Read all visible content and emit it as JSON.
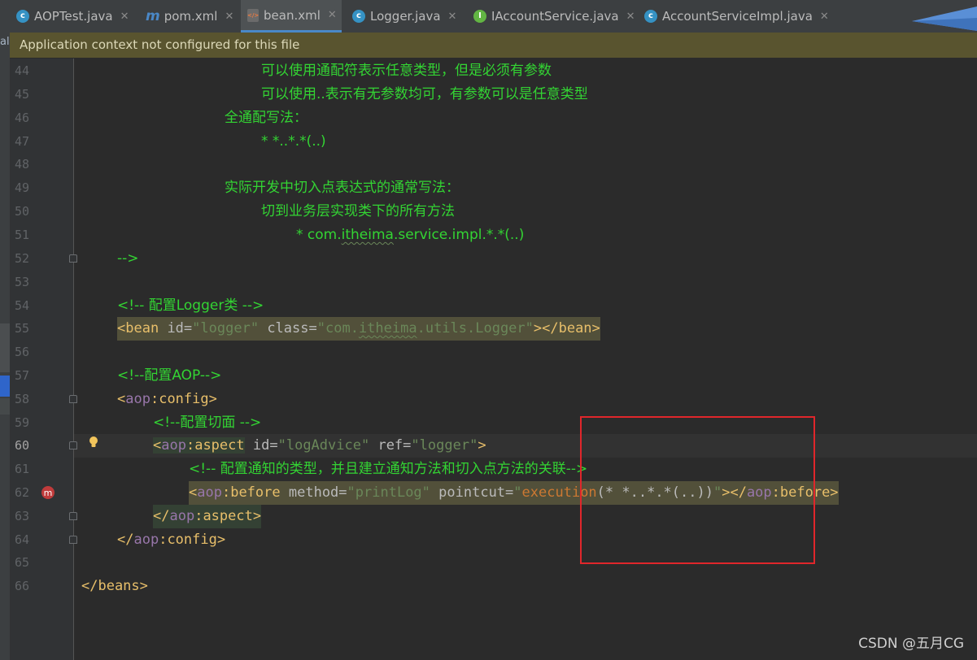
{
  "tabs": [
    {
      "label": "AOPTest.java",
      "icon": "class-icon"
    },
    {
      "label": "pom.xml",
      "icon": "maven-icon"
    },
    {
      "label": "bean.xml",
      "icon": "xml-icon",
      "active": true
    },
    {
      "label": "Logger.java",
      "icon": "class-icon"
    },
    {
      "label": "IAccountService.java",
      "icon": "interface-icon"
    },
    {
      "label": "AccountServiceImpl.java",
      "icon": "class-icon"
    }
  ],
  "side_char": "al",
  "banner": "Application context not configured for this file",
  "lines": {
    "l44": {
      "num": "44",
      "c": "可以使用通配符表示任意类型，但是必须有参数"
    },
    "l45": {
      "num": "45",
      "c": "可以使用..表示有无参数均可，有参数可以是任意类型"
    },
    "l46": {
      "num": "46",
      "c": "全通配写法："
    },
    "l47": {
      "num": "47",
      "c": "* *..*.*(..)"
    },
    "l48": {
      "num": "48"
    },
    "l49": {
      "num": "49",
      "c": "实际开发中切入点表达式的通常写法："
    },
    "l50": {
      "num": "50",
      "c": "切到业务层实现类下的所有方法"
    },
    "l51": {
      "num": "51",
      "c1": "* com.",
      "c2": "itheima",
      "c3": ".service.impl.*.*(..)"
    },
    "l52": {
      "num": "52",
      "c": "-->"
    },
    "l53": {
      "num": "53"
    },
    "l54": {
      "num": "54",
      "c": "<!-- 配置Logger类 -->"
    },
    "l55": {
      "num": "55",
      "open": "<bean",
      "a1": "id",
      "eq1": "=",
      "v1": "\"logger\"",
      "a2": "class",
      "eq2": "=",
      "v2a": "\"com.",
      "v2b": "itheima",
      "v2c": ".utils.Logger\"",
      "close": "></bean>"
    },
    "l56": {
      "num": "56"
    },
    "l57": {
      "num": "57",
      "c": "<!--配置AOP-->"
    },
    "l58": {
      "num": "58",
      "lt": "<",
      "ns": "aop",
      "name": ":config",
      "gt": ">"
    },
    "l59": {
      "num": "59",
      "c": "<!--配置切面 -->"
    },
    "l60": {
      "num": "60",
      "lt": "<",
      "ns": "aop",
      "name": ":aspect",
      "a1": "id",
      "eq1": "=",
      "v1": "\"logAdvice\"",
      "a2": "ref",
      "eq2": "=",
      "v2": "\"logger\"",
      "gt": ">"
    },
    "l61": {
      "num": "61",
      "c": "<!-- 配置通知的类型，并且建立通知方法和切入点方法的关联-->"
    },
    "l62": {
      "num": "62",
      "lt": "<",
      "ns": "aop",
      "name": ":before",
      "a1": "method",
      "eq1": "=",
      "v1": "\"printLog\"",
      "a2": "pointcut",
      "eq2": "=",
      "q1": "\"",
      "kw": "execution",
      "expr": "(* *..*.*(..))",
      "q2": "\"",
      "close1": "></",
      "ns2": "aop",
      "close2": ":before>"
    },
    "l63": {
      "num": "63",
      "lt": "</",
      "ns": "aop",
      "name": ":aspect>"
    },
    "l64": {
      "num": "64",
      "lt": "</",
      "ns": "aop",
      "name": ":config>"
    },
    "l65": {
      "num": "65"
    },
    "l66": {
      "num": "66",
      "c": "</beans>"
    }
  },
  "watermark": "CSDN @五月CG",
  "colors": {
    "comment": "#33d433",
    "tag": "#e8bf6a",
    "namespace": "#9876aa",
    "value": "#6a8759",
    "highlight_box": "#e0262b"
  }
}
